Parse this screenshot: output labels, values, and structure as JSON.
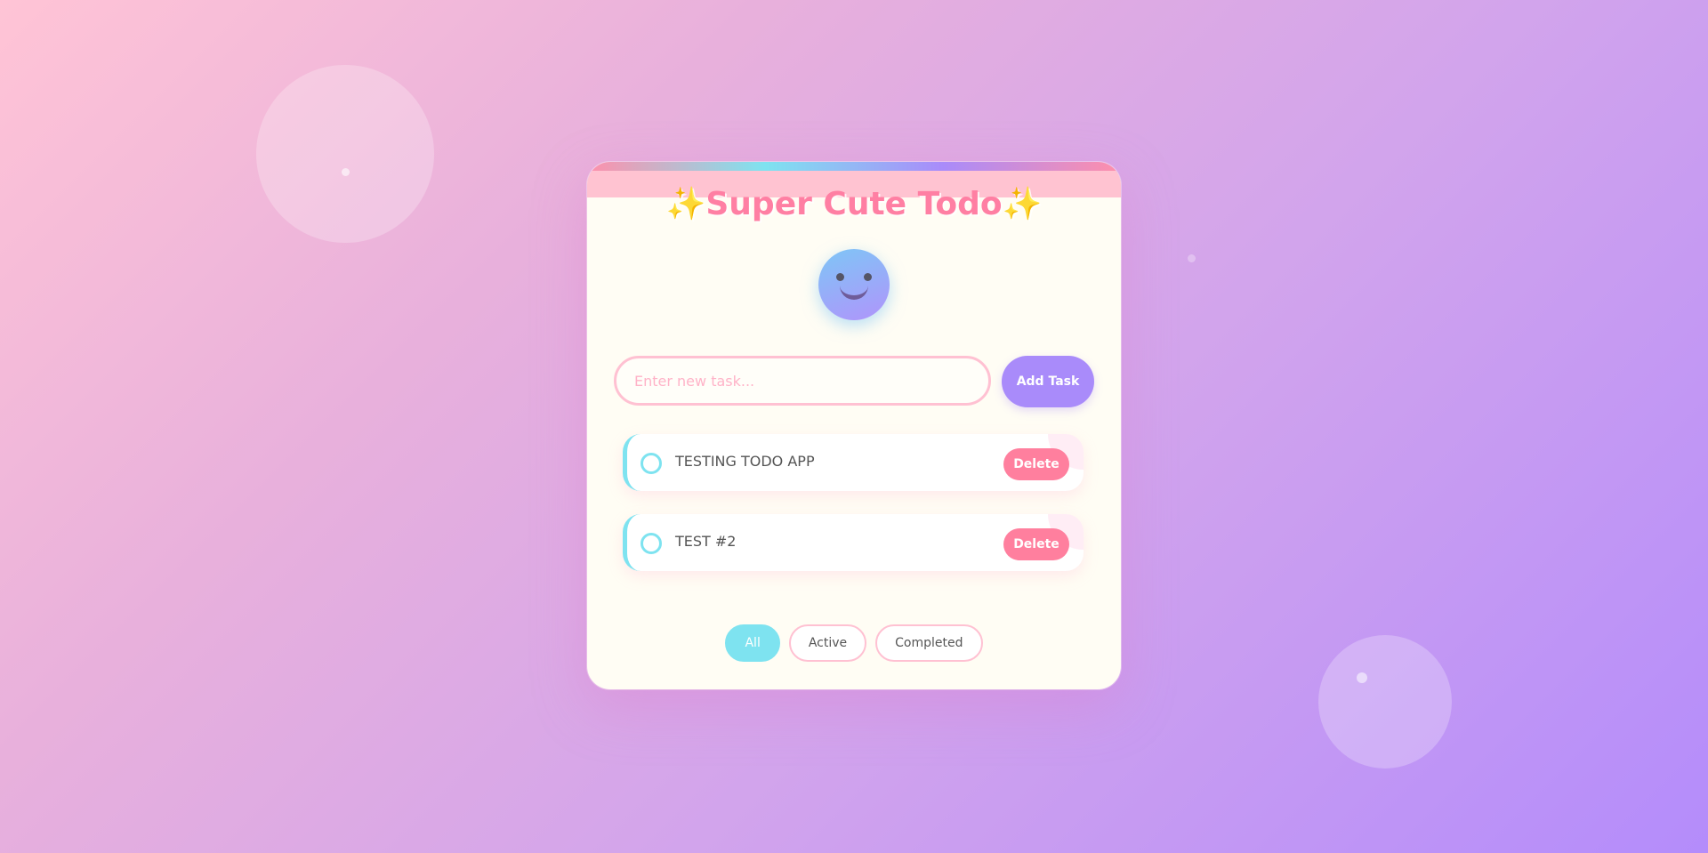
{
  "app": {
    "title_sparkle_left": "✨",
    "title_text": "Super Cute Todo",
    "title_sparkle_right": "✨"
  },
  "mascot": {
    "icon": "smiley-face-icon"
  },
  "new_task": {
    "placeholder": "Enter new task...",
    "value": "",
    "add_label": "Add Task"
  },
  "todos": [
    {
      "text": "TESTING TODO APP",
      "completed": false,
      "delete_label": "Delete"
    },
    {
      "text": "TEST #2",
      "completed": false,
      "delete_label": "Delete"
    }
  ],
  "filters": [
    {
      "label": "All",
      "active": true
    },
    {
      "label": "Active",
      "active": false
    },
    {
      "label": "Completed",
      "active": false
    }
  ],
  "colors": {
    "accent_pink": "#ff7fa3",
    "accent_cyan": "#7ee3f0",
    "accent_purple": "#a98bfa",
    "sparkle_gold": "#f7c61b"
  }
}
